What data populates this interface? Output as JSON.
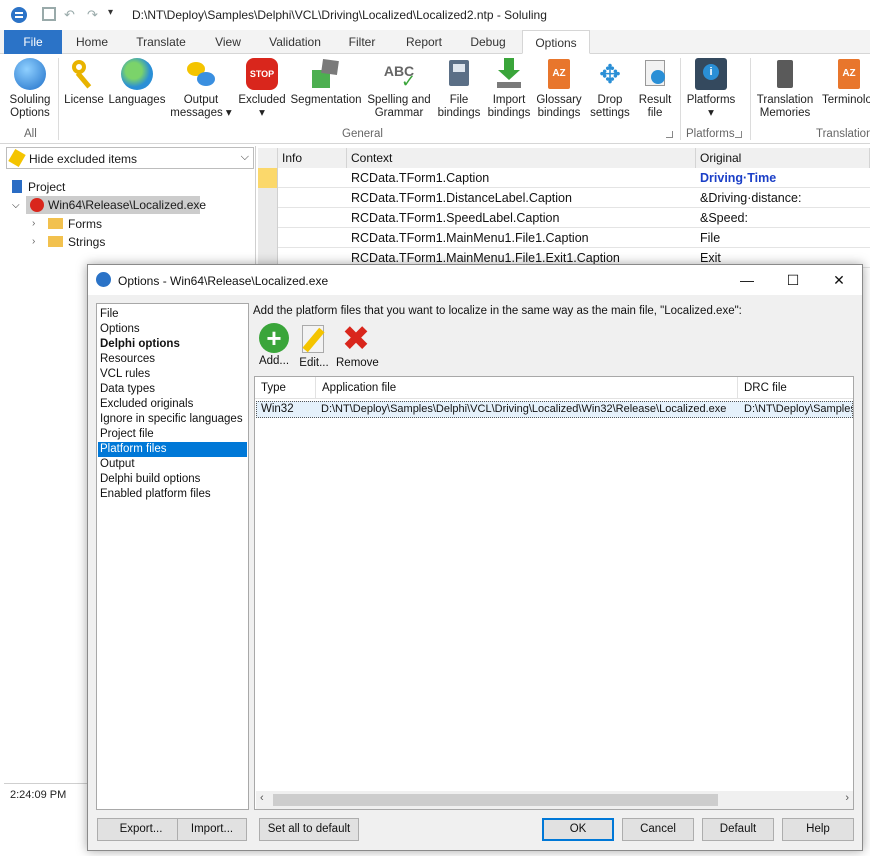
{
  "window": {
    "title": "D:\\NT\\Deploy\\Samples\\Delphi\\VCL\\Driving\\Localized\\Localized2.ntp  -  Soluling"
  },
  "ribbon": {
    "tabs": [
      {
        "label": "File"
      },
      {
        "label": "Home"
      },
      {
        "label": "Translate"
      },
      {
        "label": "View"
      },
      {
        "label": "Validation"
      },
      {
        "label": "Filter"
      },
      {
        "label": "Report"
      },
      {
        "label": "Debug"
      },
      {
        "label": "Options"
      }
    ],
    "active_tab": "Options",
    "buttons": [
      {
        "label": "Soluling\nOptions",
        "icon": "globe-icon"
      },
      {
        "label": "License",
        "icon": "key-icon"
      },
      {
        "label": "Languages",
        "icon": "earth-icon"
      },
      {
        "label": "Output\nmessages ▾",
        "icon": "messages-icon"
      },
      {
        "label": "Excluded\n▾",
        "icon": "stop-icon"
      },
      {
        "label": "Segmentation",
        "icon": "segmentation-icon"
      },
      {
        "label": "Spelling and\nGrammar",
        "icon": "spellcheck-icon"
      },
      {
        "label": "File\nbindings",
        "icon": "file-bindings-icon"
      },
      {
        "label": "Import\nbindings",
        "icon": "import-icon"
      },
      {
        "label": "Glossary\nbindings",
        "icon": "glossary-icon"
      },
      {
        "label": "Drop\nsettings",
        "icon": "drop-icon"
      },
      {
        "label": "Result\nfile",
        "icon": "result-file-icon"
      },
      {
        "label": "Platforms\n▾",
        "icon": "platforms-icon"
      },
      {
        "label": "Translation\nMemories",
        "icon": "tm-icon"
      },
      {
        "label": "Terminolo",
        "icon": "terminology-icon"
      }
    ],
    "groups": {
      "all": "All",
      "general": "General",
      "platforms": "Platforms",
      "translation": "Translation"
    }
  },
  "left_panel": {
    "filter": "Hide excluded items",
    "tree": {
      "project": "Project",
      "exe": "Win64\\Release\\Localized.exe",
      "forms": "Forms",
      "strings": "Strings"
    },
    "time": "2:24:09 PM"
  },
  "grid": {
    "headers": {
      "info": "Info",
      "context": "Context",
      "original": "Original"
    },
    "rows": [
      {
        "context": "RCData.TForm1.Caption",
        "original": "Driving·Time"
      },
      {
        "context": "RCData.TForm1.DistanceLabel.Caption",
        "original": "&Driving·distance:"
      },
      {
        "context": "RCData.TForm1.SpeedLabel.Caption",
        "original": "&Speed:"
      },
      {
        "context": "RCData.TForm1.MainMenu1.File1.Caption",
        "original": "File"
      },
      {
        "context": "RCData.TForm1.MainMenu1.File1.Exit1.Caption",
        "original": "Exit"
      }
    ]
  },
  "dialog": {
    "title": "Options - Win64\\Release\\Localized.exe",
    "nav": [
      {
        "label": "File"
      },
      {
        "label": "Options"
      },
      {
        "label": "Delphi options"
      },
      {
        "label": "Resources"
      },
      {
        "label": "VCL rules"
      },
      {
        "label": "Data types"
      },
      {
        "label": "Excluded originals"
      },
      {
        "label": "Ignore in specific languages"
      },
      {
        "label": "Project file"
      },
      {
        "label": "Platform files"
      },
      {
        "label": "Output"
      },
      {
        "label": "Delphi build options"
      },
      {
        "label": "Enabled platform files"
      }
    ],
    "instruction": "Add the platform files that you want to localize in the same way as the main file, \"Localized.exe\":",
    "toolbar": {
      "add": "Add...",
      "edit": "Edit...",
      "remove": "Remove"
    },
    "table": {
      "headers": {
        "type": "Type",
        "application_file": "Application file",
        "drc_file": "DRC file"
      },
      "rows": [
        {
          "type": "Win32",
          "application_file": "D:\\NT\\Deploy\\Samples\\Delphi\\VCL\\Driving\\Localized\\Win32\\Release\\Localized.exe",
          "drc_file": "D:\\NT\\Deploy\\Samples"
        }
      ]
    },
    "buttons": {
      "export": "Export...",
      "import": "Import...",
      "set_all_default": "Set all to default",
      "ok": "OK",
      "cancel": "Cancel",
      "default": "Default",
      "help": "Help"
    }
  },
  "colors": {
    "accent": "#2b73c7",
    "selection": "#0078d7",
    "original_highlight": "#1b3fc7"
  }
}
